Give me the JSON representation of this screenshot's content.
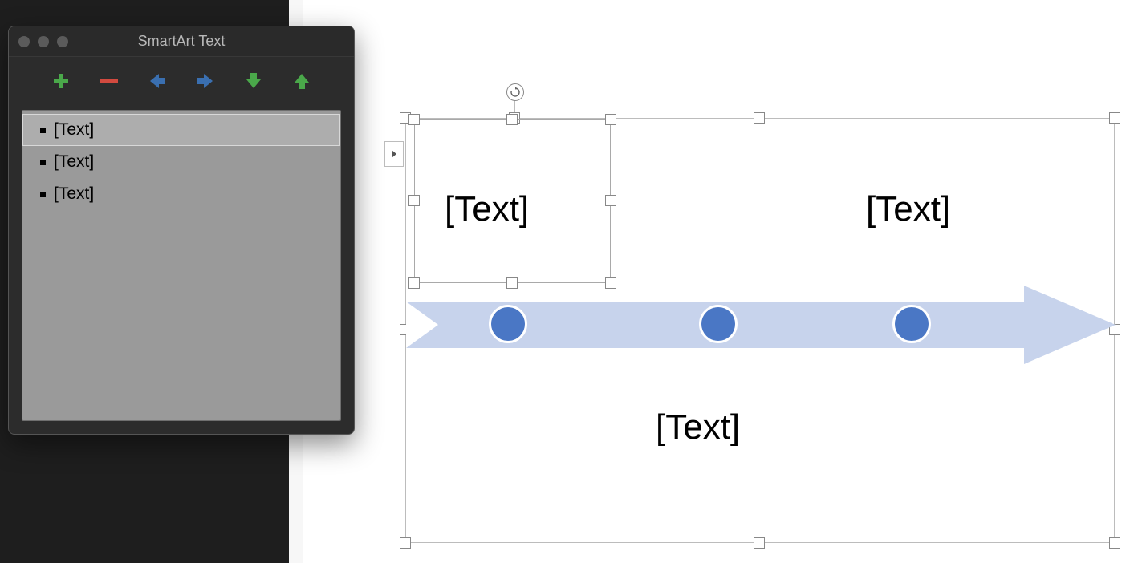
{
  "panel": {
    "title": "SmartArt Text",
    "items": [
      {
        "label": "[Text]"
      },
      {
        "label": "[Text]"
      },
      {
        "label": "[Text]"
      }
    ]
  },
  "colors": {
    "arrow_fill": "#c7d3ec",
    "dot_fill": "#4a77c5",
    "toolbar_green": "#4aa84a",
    "toolbar_red": "#d24a3f",
    "toolbar_blue": "#3a6fb0",
    "toolbar_green2": "#4aa84a"
  },
  "smartart": {
    "labels": {
      "top1": "[Text]",
      "top2": "[Text]",
      "bottom": "[Text]"
    }
  }
}
